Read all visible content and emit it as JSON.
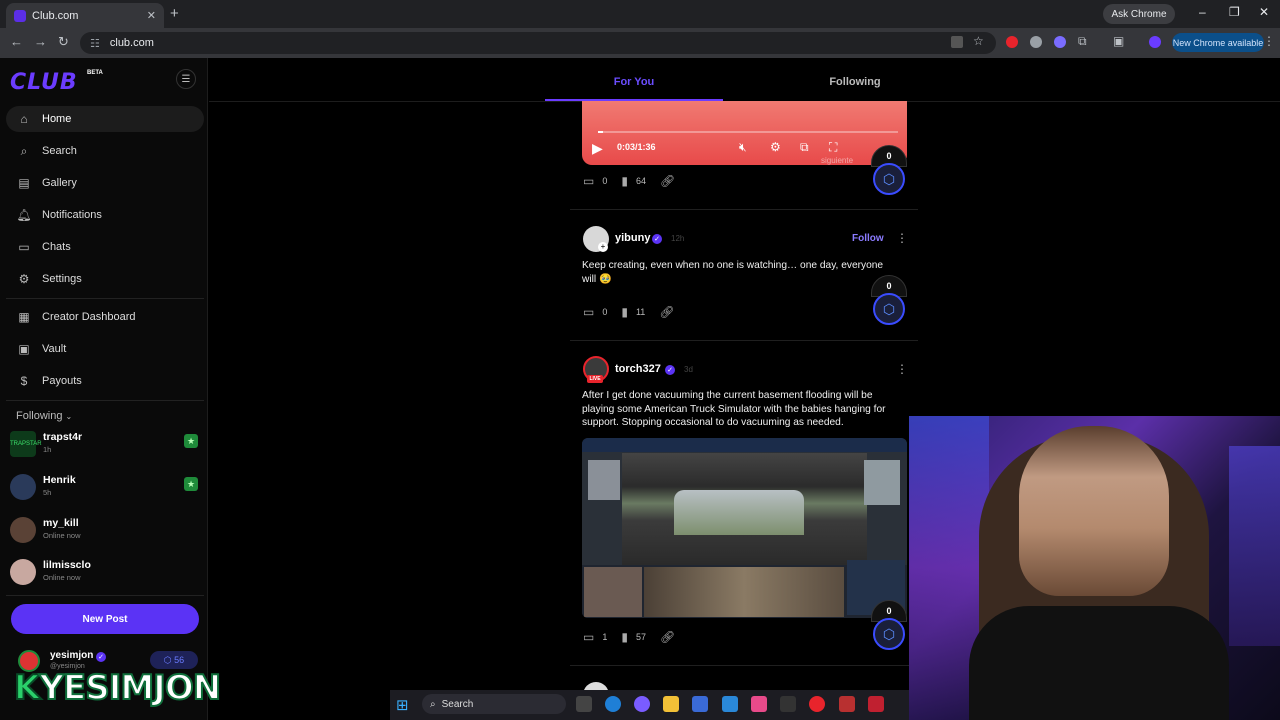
{
  "browser": {
    "tab_title": "Club.com",
    "url": "club.com",
    "ask_chrome": "Ask Chrome",
    "new_chrome": "New Chrome available",
    "new_tab_glyph": "+"
  },
  "app": {
    "logo": "CLUB",
    "beta": "BETA",
    "nav": [
      {
        "label": "Home",
        "icon": "home-icon"
      },
      {
        "label": "Search",
        "icon": "search-icon"
      },
      {
        "label": "Gallery",
        "icon": "gallery-icon"
      },
      {
        "label": "Notifications",
        "icon": "bell-icon"
      },
      {
        "label": "Chats",
        "icon": "chat-icon"
      },
      {
        "label": "Settings",
        "icon": "gear-icon"
      },
      {
        "label": "Creator Dashboard",
        "icon": "dashboard-icon"
      },
      {
        "label": "Vault",
        "icon": "vault-icon"
      },
      {
        "label": "Payouts",
        "icon": "dollar-icon"
      }
    ],
    "following_header": "Following",
    "following": [
      {
        "name": "trapst4r",
        "status": "1h",
        "starred": true
      },
      {
        "name": "Henrik",
        "status": "5h",
        "starred": true
      },
      {
        "name": "my_kill",
        "status": "Online now",
        "starred": false
      },
      {
        "name": "lilmissclo",
        "status": "Online now",
        "starred": false
      }
    ],
    "new_post": "New Post",
    "me": {
      "name": "yesimjon",
      "handle": "@yesimjon",
      "points": "56"
    },
    "watermark_k": "K",
    "watermark": "YESIMJON"
  },
  "feed": {
    "tabs": [
      "For You",
      "Following"
    ],
    "video": {
      "time": "0:03/1:36",
      "overlay_text": "siguiente"
    },
    "posts": [
      {
        "comments": "0",
        "views": "64",
        "tips": "0"
      },
      {
        "author": "yibuny",
        "time": "12h",
        "follow": "Follow",
        "text": "Keep creating, even when no one is watching… one day, everyone will 🥹",
        "comments": "0",
        "views": "11",
        "tips": "0"
      },
      {
        "author": "torch327",
        "time": "3d",
        "live": "LIVE",
        "text": "After I get done vacuuming the current basement flooding will be playing some American Truck Simulator with the babies hanging for support. Stopping occasional to do vacuuming as needed.",
        "comments": "1",
        "views": "57",
        "tips": "0"
      }
    ]
  },
  "taskbar": {
    "search": "Search"
  }
}
